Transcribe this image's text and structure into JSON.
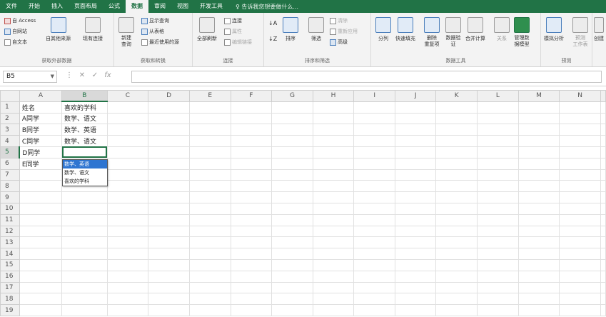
{
  "tabs": [
    "文件",
    "开始",
    "插入",
    "页面布局",
    "公式",
    "数据",
    "审阅",
    "视图",
    "开发工具"
  ],
  "active_tab": "数据",
  "tell_me": "告诉我您想要做什么...",
  "ribbon": {
    "ext": {
      "access": "自 Access",
      "web": "自网站",
      "text": "自文本",
      "other": "自其他来源",
      "existing": "现有连接",
      "label": "获取外部数据"
    },
    "transform": {
      "new_query": "新建\n查询",
      "show_query": "显示查询",
      "from_table": "从表格",
      "recent": "最近使用的源",
      "label": "获取和转换"
    },
    "connections": {
      "refresh_all": "全部刷新",
      "connections": "连接",
      "properties": "属性",
      "edit_links": "编辑链接",
      "label": "连接"
    },
    "sort": {
      "sort": "排序",
      "filter": "筛选",
      "clear": "清除",
      "reapply": "重新应用",
      "advanced": "高级",
      "label": "排序和筛选"
    },
    "tools": {
      "split": "分列",
      "flash_fill": "快速填充",
      "remove_dup": "删除\n重复项",
      "validation": "数据验\n证",
      "consolidate": "合并计算",
      "relations": "关系",
      "manage_model": "管理数\n据模型",
      "label": "数据工具"
    },
    "forecast": {
      "whatif": "模拟分析",
      "sheet": "预测\n工作表",
      "label": "预测"
    },
    "outline": {
      "group": "创建"
    }
  },
  "formula_bar": {
    "cell": "B5",
    "value": ""
  },
  "columns": [
    "A",
    "B",
    "C",
    "D",
    "E",
    "F",
    "G",
    "H",
    "I",
    "J",
    "K",
    "L",
    "M",
    "N"
  ],
  "rows": [
    [
      "姓名",
      "喜欢的学科"
    ],
    [
      "A同学",
      "数学、语文"
    ],
    [
      "B同学",
      "数学、英语"
    ],
    [
      "C同学",
      "数学、语文"
    ],
    [
      "D同学",
      ""
    ],
    [
      "E同学",
      ""
    ],
    [
      "",
      ""
    ],
    [
      "",
      ""
    ],
    [
      "",
      ""
    ],
    [
      "",
      ""
    ],
    [
      "",
      ""
    ],
    [
      "",
      ""
    ],
    [
      "",
      ""
    ],
    [
      "",
      ""
    ],
    [
      "",
      ""
    ],
    [
      "",
      ""
    ],
    [
      "",
      ""
    ],
    [
      "",
      ""
    ],
    [
      "",
      ""
    ]
  ],
  "dropdown": {
    "options": [
      "数学、英语",
      "数学、语文",
      "喜欢的学科"
    ],
    "highlighted": 0
  }
}
